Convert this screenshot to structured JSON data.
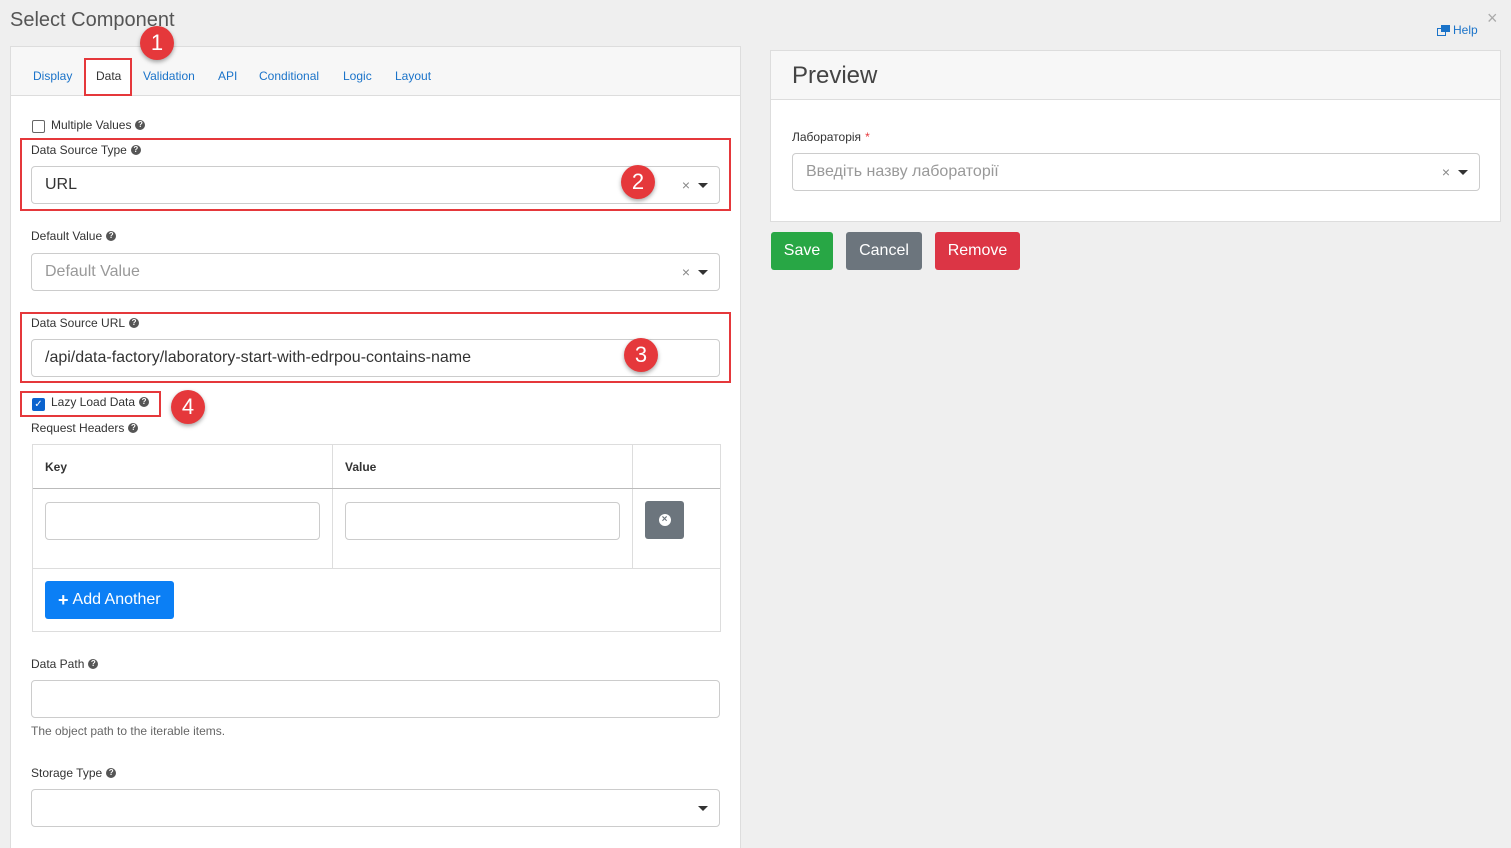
{
  "dialog": {
    "title": "Select Component",
    "help_label": "Help",
    "close": "×"
  },
  "tabs": [
    {
      "label": "Display"
    },
    {
      "label": "Data"
    },
    {
      "label": "Validation"
    },
    {
      "label": "API"
    },
    {
      "label": "Conditional"
    },
    {
      "label": "Logic"
    },
    {
      "label": "Layout"
    }
  ],
  "data_tab": {
    "multiple_values": {
      "label": "Multiple Values",
      "checked": false
    },
    "data_source_type": {
      "label": "Data Source Type",
      "value": "URL"
    },
    "default_value": {
      "label": "Default Value",
      "placeholder": "Default Value"
    },
    "data_source_url": {
      "label": "Data Source URL",
      "value": "/api/data-factory/laboratory-start-with-edrpou-contains-name"
    },
    "lazy_load": {
      "label": "Lazy Load Data",
      "checked": true
    },
    "request_headers": {
      "label": "Request Headers",
      "col_key": "Key",
      "col_value": "Value",
      "add_label": "Add Another"
    },
    "data_path": {
      "label": "Data Path",
      "value": "",
      "hint": "The object path to the iterable items."
    },
    "storage_type": {
      "label": "Storage Type",
      "value": ""
    }
  },
  "annotations": [
    "1",
    "2",
    "3",
    "4"
  ],
  "preview": {
    "title": "Preview",
    "field_label": "Лабораторія",
    "required_mark": "*",
    "placeholder": "Введіть назву лабораторії"
  },
  "actions": {
    "save": "Save",
    "cancel": "Cancel",
    "remove": "Remove"
  },
  "colors": {
    "save": "#28a745",
    "cancel": "#6c757d",
    "remove": "#dc3545",
    "primary": "#0b7ff5",
    "annotation": "#e5383b"
  }
}
